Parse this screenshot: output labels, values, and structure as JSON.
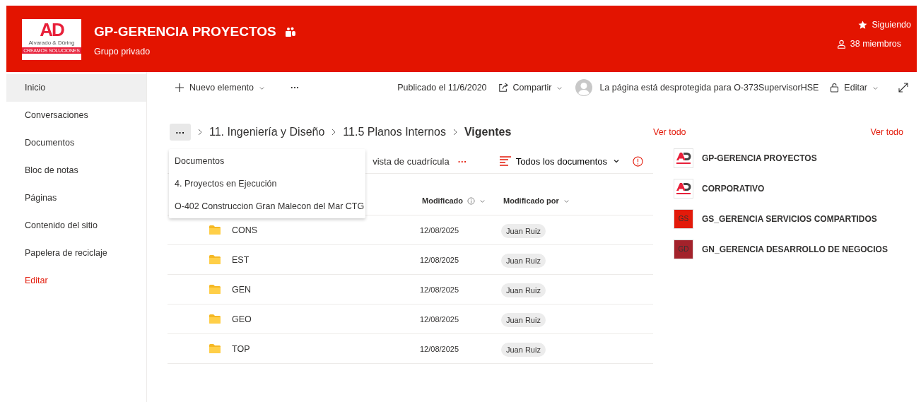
{
  "header": {
    "logo": {
      "mark": "AD",
      "name": "Alvarado & Düring",
      "tagline": "CREAMOS SOLUCIONES"
    },
    "title": "GP-GERENCIA PROYECTOS",
    "subtitle": "Grupo privado",
    "follow": "Siguiendo",
    "members": "38 miembros"
  },
  "sidebar": {
    "items": [
      {
        "label": "Inicio",
        "kind": "nav",
        "selected": true
      },
      {
        "label": "Conversaciones",
        "kind": "nav",
        "selected": false
      },
      {
        "label": "Documentos",
        "kind": "nav",
        "selected": false
      },
      {
        "label": "Bloc de notas",
        "kind": "nav",
        "selected": false
      },
      {
        "label": "Páginas",
        "kind": "nav",
        "selected": false
      },
      {
        "label": "Contenido del sitio",
        "kind": "nav",
        "selected": false
      },
      {
        "label": "Papelera de reciclaje",
        "kind": "nav",
        "selected": false
      },
      {
        "label": "Editar",
        "kind": "action",
        "selected": false
      }
    ]
  },
  "toolbar": {
    "new_item": "Nuevo elemento",
    "more": "···",
    "published": "Publicado el 11/6/2020",
    "share": "Compartir",
    "checkout_notice": "La página está desprotegida para O-373SupervisorHSE",
    "edit": "Editar"
  },
  "breadcrumb": {
    "more": "···",
    "items": [
      "11. Ingeniería y Diseño",
      "11.5 Planos Internos",
      "Vigentes"
    ]
  },
  "breadcrumb_menu": [
    "Documentos",
    "4. Proyectos en Ejecución",
    "O-402 Construccion Gran Malecon del Mar CTG"
  ],
  "command_bar": {
    "view_partial": "vista de cuadrícula",
    "more": "···",
    "view": "Todos los documentos"
  },
  "list_see_all": "Ver todo",
  "table": {
    "columns": [
      "Modificado",
      "Modificado por"
    ],
    "rows": [
      {
        "name": "CONS",
        "modified": "12/08/2025",
        "modified_by": "Juan Ruiz"
      },
      {
        "name": "EST",
        "modified": "12/08/2025",
        "modified_by": "Juan Ruiz"
      },
      {
        "name": "GEN",
        "modified": "12/08/2025",
        "modified_by": "Juan Ruiz"
      },
      {
        "name": "GEO",
        "modified": "12/08/2025",
        "modified_by": "Juan Ruiz"
      },
      {
        "name": "TOP",
        "modified": "12/08/2025",
        "modified_by": "Juan Ruiz"
      }
    ]
  },
  "sites": {
    "see_all": "Ver todo",
    "items": [
      {
        "name": "GP-GERENCIA PROYECTOS",
        "kind": "logo"
      },
      {
        "name": "CORPORATIVO",
        "kind": "logo"
      },
      {
        "name": "GS_GERENCIA SERVICIOS COMPARTIDOS",
        "kind": "initials",
        "initials": "GS",
        "color": "#e31a0a"
      },
      {
        "name": "GN_GERENCIA DESARROLLO DE NEGOCIOS",
        "kind": "initials",
        "initials": "GD",
        "color": "#a3222b"
      }
    ]
  }
}
